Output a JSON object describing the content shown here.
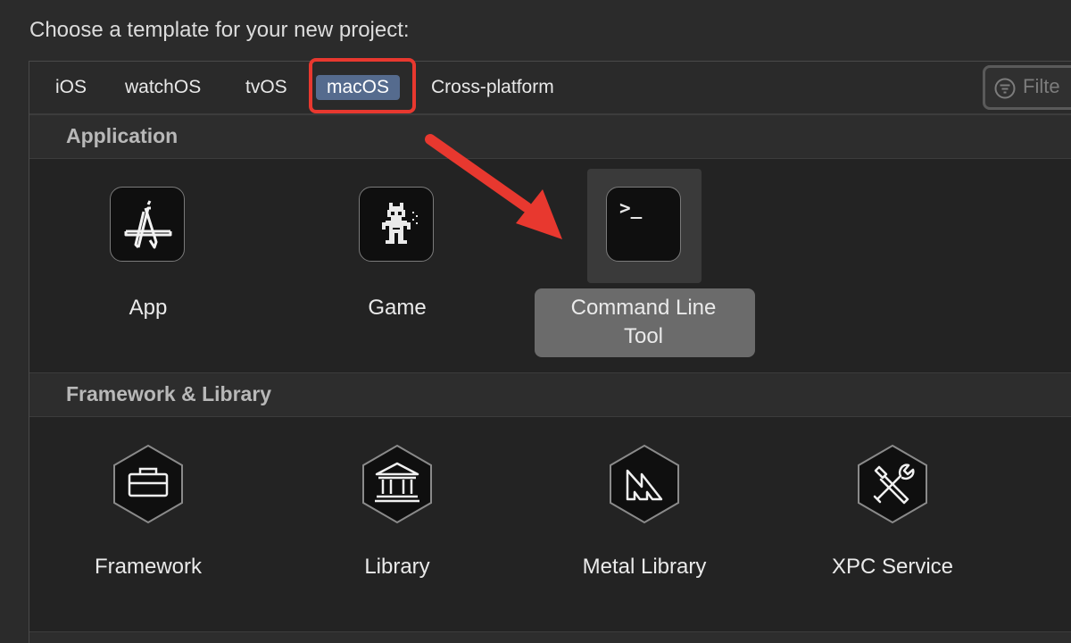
{
  "prompt": "Choose a template for your new project:",
  "tabs": [
    {
      "label": "iOS",
      "selected": false
    },
    {
      "label": "watchOS",
      "selected": false
    },
    {
      "label": "tvOS",
      "selected": false
    },
    {
      "label": "macOS",
      "selected": true
    },
    {
      "label": "Cross-platform",
      "selected": false
    }
  ],
  "filter": {
    "placeholder": "Filte",
    "icon": "filter-icon"
  },
  "sections": [
    {
      "title": "Application",
      "items": [
        {
          "label": "App",
          "icon": "app-store-a-icon"
        },
        {
          "label": "Game",
          "icon": "game-sprite-icon"
        },
        {
          "label": "Command Line Tool",
          "icon": "terminal-icon",
          "selected": true,
          "glyph": ">_"
        }
      ]
    },
    {
      "title": "Framework & Library",
      "items": [
        {
          "label": "Framework",
          "icon": "toolbox-icon"
        },
        {
          "label": "Library",
          "icon": "library-building-icon"
        },
        {
          "label": "Metal Library",
          "icon": "metal-icon"
        },
        {
          "label": "XPC Service",
          "icon": "wrench-screwdriver-icon"
        }
      ]
    }
  ],
  "colors": {
    "selected_tab": "#556b8e",
    "annotation_red": "#e8382f",
    "selected_label_bg": "#6b6b6b"
  }
}
